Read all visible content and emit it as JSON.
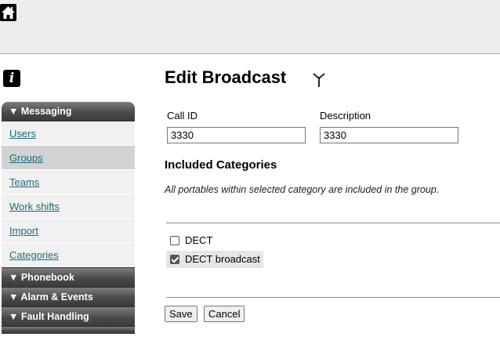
{
  "icons": {
    "home": "home-icon",
    "info": "info-icon",
    "info_glyph": "i",
    "antenna": "antenna-icon"
  },
  "sidebar": {
    "sections": [
      {
        "label": "▼ Messaging",
        "items": [
          {
            "label": "Users",
            "active": false
          },
          {
            "label": "Groups",
            "active": true
          },
          {
            "label": "Teams",
            "active": false
          },
          {
            "label": "Work shifts",
            "active": false
          },
          {
            "label": "Import",
            "active": false
          },
          {
            "label": "Categories",
            "active": false
          }
        ]
      },
      {
        "label": "▼ Phonebook"
      },
      {
        "label": "▼ Alarm & Events"
      },
      {
        "label": "▼ Fault Handling"
      }
    ]
  },
  "main": {
    "title": "Edit Broadcast",
    "call_id": {
      "label": "Call ID",
      "value": "3330"
    },
    "description": {
      "label": "Description",
      "value": "3330"
    },
    "categories_title": "Included Categories",
    "categories_note": "All portables within selected category are included in the group.",
    "categories": [
      {
        "label": "DECT",
        "checked": false
      },
      {
        "label": "DECT broadcast",
        "checked": true
      }
    ],
    "save_label": "Save",
    "cancel_label": "Cancel"
  },
  "colors": {
    "link": "#1a6b7a",
    "header_dark": "#3a3a3a",
    "active_item": "#d2d2d2"
  }
}
